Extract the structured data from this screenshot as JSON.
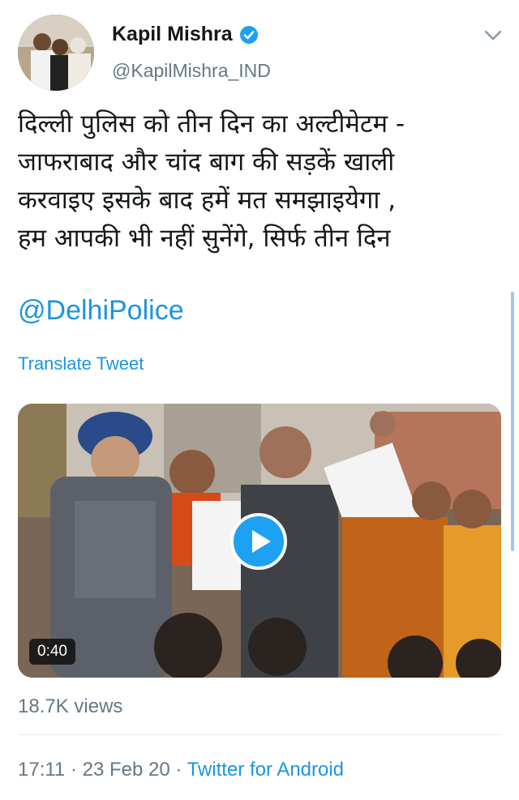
{
  "user": {
    "name": "Kapil Mishra",
    "handle": "@KapilMishra_IND",
    "verified": true
  },
  "tweet": {
    "lines": [
      "दिल्ली पुलिस को तीन दिन का अल्टीमेटम -",
      "जाफराबाद और चांद बाग की सड़कें खाली",
      "करवाइए इसके बाद हमें मत समझाइयेगा ,",
      "हम आपकी भी नहीं सुनेंगे, सिर्फ तीन दिन"
    ],
    "mention": "@DelhiPolice",
    "translate_label": "Translate Tweet"
  },
  "media": {
    "type": "video",
    "duration": "0:40",
    "play_icon": "play-icon"
  },
  "stats": {
    "views": "18.7K views"
  },
  "meta": {
    "time": "17:11",
    "separator": " · ",
    "date": "23 Feb 20",
    "client": "Twitter for Android"
  },
  "colors": {
    "accent": "#1b95e0",
    "secondary_text": "#657786"
  }
}
